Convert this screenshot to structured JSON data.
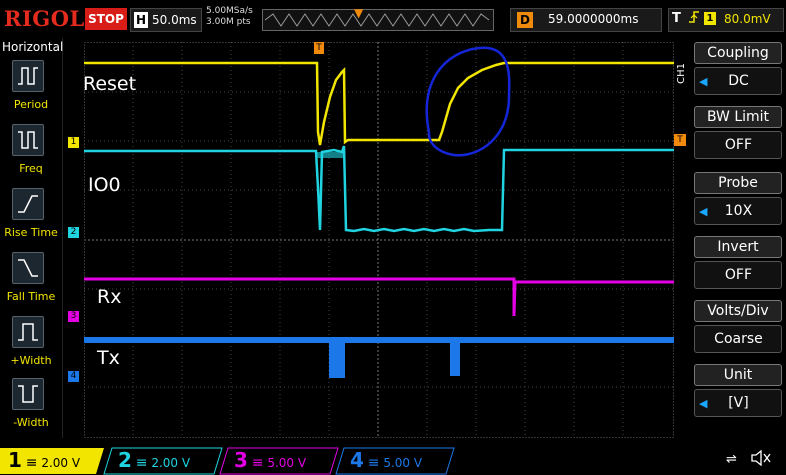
{
  "brand": "RIGOL",
  "run_state": "STOP",
  "timebase": {
    "letter": "H",
    "value": "50.0ms"
  },
  "sample_rate": {
    "rate": "5.00MSa/s",
    "points": "3.00M pts"
  },
  "delay": {
    "letter": "D",
    "value": "59.0000000ms"
  },
  "trigger": {
    "letter": "T",
    "edge_icon": "rising-edge",
    "source": "1",
    "level": "80.0mV"
  },
  "horizontal_panel": {
    "title": "Horizontal",
    "buttons": [
      "Period",
      "Freq",
      "Rise Time",
      "Fall Time",
      "+Width",
      "-Width"
    ]
  },
  "channel_panel": {
    "side_label": "CH1",
    "items": [
      {
        "title": "Coupling",
        "value": "DC"
      },
      {
        "title": "BW Limit",
        "value": "OFF"
      },
      {
        "title": "Probe",
        "value": "10X"
      },
      {
        "title": "Invert",
        "value": "OFF"
      },
      {
        "title": "Volts/Div",
        "value": "Coarse"
      },
      {
        "title": "Unit",
        "value": "[V]"
      }
    ]
  },
  "traces": {
    "ch1_label": "Reset",
    "ch2_label": "IO0",
    "ch3_label": "Rx",
    "ch4_label": "Tx"
  },
  "markers": {
    "ch1": "1",
    "ch2": "2",
    "ch3": "3",
    "ch4": "4",
    "trig": "T"
  },
  "channels": [
    {
      "num": "1",
      "scale": "2.00 V",
      "color": "#f2e500"
    },
    {
      "num": "2",
      "scale": "2.00 V",
      "color": "#1fd3e0"
    },
    {
      "num": "3",
      "scale": "5.00 V",
      "color": "#d800d8"
    },
    {
      "num": "4",
      "scale": "5.00 V",
      "color": "#1c78e8"
    }
  ],
  "status_icons": [
    "usb-icon",
    "speaker-mute-icon"
  ],
  "colors": {
    "ch1": "#f2e500",
    "ch2": "#1fd3e0",
    "ch3": "#e400e4",
    "ch4": "#1c78e8",
    "trigger": "#f08a0d",
    "annotation": "#1426d8",
    "stop": "#d81d18"
  }
}
